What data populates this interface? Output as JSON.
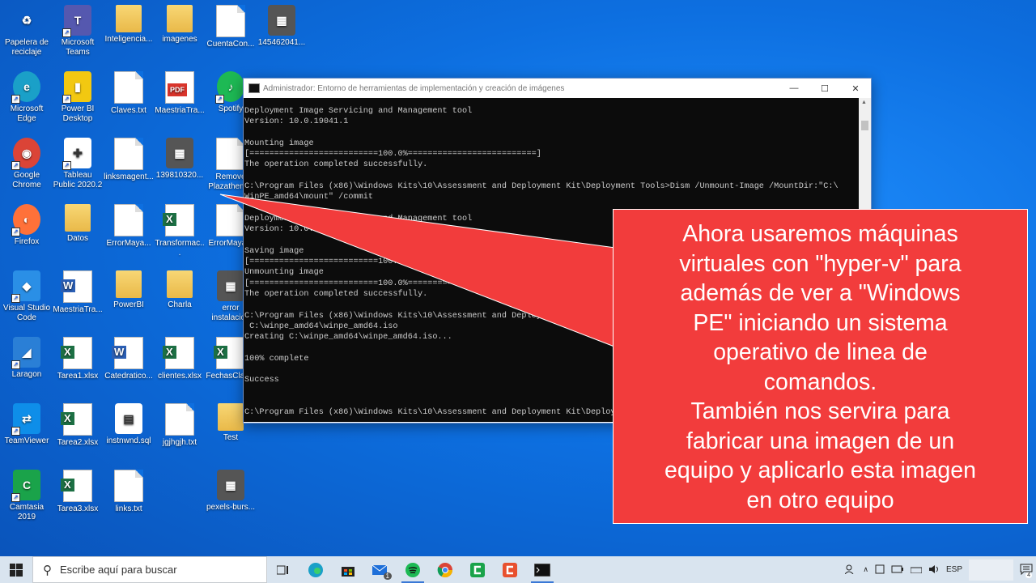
{
  "desktop_icons": [
    {
      "label": "Papelera de reciclaje",
      "type": "recycle"
    },
    {
      "label": "Microsoft Teams",
      "type": "teams"
    },
    {
      "label": "Inteligencia...",
      "type": "folder"
    },
    {
      "label": "imagenes",
      "type": "folder"
    },
    {
      "label": "CuentaCon...",
      "type": "doc"
    },
    {
      "label": "145462041...",
      "type": "image"
    },
    {
      "label": "Microsoft Edge",
      "type": "edge"
    },
    {
      "label": "Power BI Desktop",
      "type": "powerbi"
    },
    {
      "label": "Claves.txt",
      "type": "doc"
    },
    {
      "label": "MaestriaTra...",
      "type": "pdf"
    },
    {
      "label": "Spotify",
      "type": "spotify"
    },
    {
      "label": "Google Chrome",
      "type": "chrome"
    },
    {
      "label": "Tableau Public 2020.2",
      "type": "tableau"
    },
    {
      "label": "linksmagent...",
      "type": "doc"
    },
    {
      "label": "139810320...",
      "type": "image"
    },
    {
      "label": "Remove Plazathem...",
      "type": "doc"
    },
    {
      "label": "Firefox",
      "type": "firefox"
    },
    {
      "label": "Datos",
      "type": "folder"
    },
    {
      "label": "ErrorMaya...",
      "type": "doc"
    },
    {
      "label": "Transformac...",
      "type": "excel"
    },
    {
      "label": "ErrorMaya...",
      "type": "doc"
    },
    {
      "label": "Visual Studio Code",
      "type": "vscode"
    },
    {
      "label": "MaestriaTra...",
      "type": "word"
    },
    {
      "label": "PowerBI",
      "type": "folder"
    },
    {
      "label": "Charla",
      "type": "folder"
    },
    {
      "label": "error instalacion",
      "type": "image"
    },
    {
      "label": "Laragon",
      "type": "laragon"
    },
    {
      "label": "Tarea1.xlsx",
      "type": "excel"
    },
    {
      "label": "Catedratico...",
      "type": "word"
    },
    {
      "label": "clientes.xlsx",
      "type": "excel"
    },
    {
      "label": "FechasClas...",
      "type": "excel"
    },
    {
      "label": "TeamViewer",
      "type": "teamviewer"
    },
    {
      "label": "Tarea2.xlsx",
      "type": "excel"
    },
    {
      "label": "instnwnd.sql",
      "type": "sql"
    },
    {
      "label": "jgjhgjh.txt",
      "type": "doc"
    },
    {
      "label": "Test",
      "type": "folder"
    },
    {
      "label": "Camtasia 2019",
      "type": "camtasia"
    },
    {
      "label": "Tarea3.xlsx",
      "type": "excel"
    },
    {
      "label": "links.txt",
      "type": "doc"
    },
    {
      "label": "pexels-burs...",
      "type": "image"
    }
  ],
  "cmd": {
    "title": "Administrador: Entorno de herramientas de implementación y creación de imágenes",
    "minimize": "—",
    "maximize": "☐",
    "close": "✕",
    "output": "Deployment Image Servicing and Management tool\nVersion: 10.0.19041.1\n\nMounting image\n[==========================100.0%==========================]\nThe operation completed successfully.\n\nC:\\Program Files (x86)\\Windows Kits\\10\\Assessment and Deployment Kit\\Deployment Tools>Dism /Unmount-Image /MountDir:\"C:\\\nWinPE_amd64\\mount\" /commit\n\nDeployment Image Servicing and Management tool\nVersion: 10.0.19041.1\n\nSaving image\n[==========================100.0%==========================]\nUnmounting image\n[==========================100.0%==========================]\nThe operation completed successfully.\n\nC:\\Program Files (x86)\\Windows Kits\\10\\Assessment and Deployment Kit\\Deployment Tools>MakeWinPEMedia /ISO C:\\WinPE_amd64\n C:\\winpe_amd64\\winpe_amd64.iso\nCreating C:\\winpe_amd64\\winpe_amd64.iso...\n\n100% complete\n\nSuccess\n\n\nC:\\Program Files (x86)\\Windows Kits\\10\\Assessment and Deployment Kit\\Deployment Tools>"
  },
  "callout": {
    "text": "Ahora usaremos máquinas\nvirtuales con \"hyper-v\" para\nademás de ver a \"Windows\nPE\" iniciando un sistema\noperativo de linea de\ncomandos.\nTambién nos servira para\nfabricar una imagen de un\nequipo y aplicarlo esta imagen\nen otro equipo",
    "color": "#f23c3c"
  },
  "taskbar": {
    "search_placeholder": "Escribe aquí para buscar",
    "language": "ESP",
    "notification_count": "4",
    "mail_badge": "1"
  }
}
